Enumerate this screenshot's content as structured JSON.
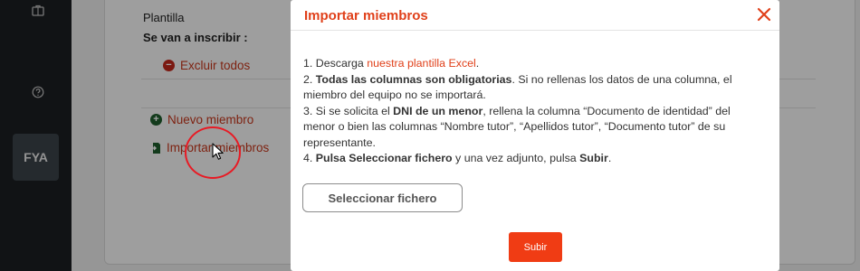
{
  "sidebar": {
    "icons": [
      "briefcase-icon",
      "help-icon"
    ],
    "avatar_label": "FYA"
  },
  "background_page": {
    "template_label": "Plantilla",
    "enroll_label": "Se van a inscribir :",
    "exclude_all": "Excluir todos",
    "new_member": "Nuevo miembro",
    "import_members": "Importar miembros"
  },
  "modal": {
    "title": "Importar miembros",
    "step1_prefix": "1. Descarga ",
    "step1_link": "nuestra plantilla Excel",
    "step1_suffix": ".",
    "step2_prefix": "2. ",
    "step2_bold": "Todas las columnas son obligatorias",
    "step2_rest": ". Si no rellenas los datos de una columna, el miembro del equipo no se importará.",
    "step3_prefix": "3. Si se solicita el ",
    "step3_bold": "DNI de un menor",
    "step3_rest": ", rellena la columna “Documento de identidad” del menor o bien las columnas “Nombre tutor”, “Apellidos tutor”, “Documento tutor” de su representante.",
    "step4_prefix": "4. ",
    "step4_bold1": "Pulsa Seleccionar fichero",
    "step4_mid": " y una vez adjunto, pulsa ",
    "step4_bold2": "Subir",
    "step4_suffix": ".",
    "select_file_button": "Seleccionar fichero",
    "submit_button": "Subir"
  },
  "colors": {
    "accent": "#e0401a",
    "submit": "#f03c14",
    "sidebar": "#1c1f21"
  }
}
